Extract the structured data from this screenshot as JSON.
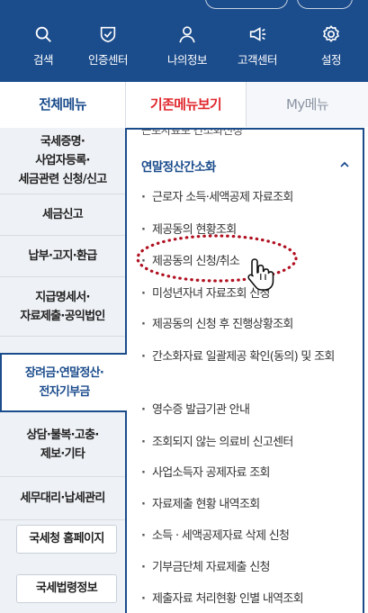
{
  "header": {
    "nav": [
      {
        "label": "검색",
        "icon": "search-icon"
      },
      {
        "label": "인증센터",
        "icon": "shield-check-icon"
      },
      {
        "label": "나의정보",
        "icon": "person-icon"
      },
      {
        "label": "고객센터",
        "icon": "megaphone-icon"
      },
      {
        "label": "설정",
        "icon": "gear-icon"
      }
    ]
  },
  "tabs": {
    "all_menu": "전체메뉴",
    "classic_menu": "기존메뉴보기",
    "my_menu": "My메뉴"
  },
  "left_menu": {
    "categories": [
      "국세증명·\n사업자등록·\n세금관련 신청/신고",
      "세금신고",
      "납부·고지·환급",
      "지급명세서·\n자료제출·공익법인",
      "장려금·연말정산·\n전자기부금",
      "상담·불복·고충·\n제보·기타",
      "세무대리·납세관리"
    ],
    "buttons": [
      "국세청 홈페이지",
      "국세법령정보"
    ]
  },
  "right_menu": {
    "cut_top_item": "근로자료보 간소화신청",
    "section_title": "연말정산간소화",
    "items": [
      "근로자 소득·세액공제 자료조회",
      "제공동의 현황조회",
      "제공동의 신청/취소",
      "미성년자녀 자료조회 신청",
      "제공동의 신청 후 진행상황조회",
      "간소화자료 일괄제공 확인(동의) 및 조회",
      "영수증 발급기관 안내",
      "조회되지 않는 의료비 신고센터",
      "사업소득자 공제자료 조회",
      "자료제출 현황 내역조회",
      "소득 · 세액공제자료 삭제 신청",
      "기부금단체 자료제출 신청",
      "제출자료 처리현황 인별 내역조회"
    ]
  },
  "colors": {
    "brand_blue": "#1b4c8c",
    "tab_red": "#e0282e",
    "highlight_dots": "#b01020"
  }
}
